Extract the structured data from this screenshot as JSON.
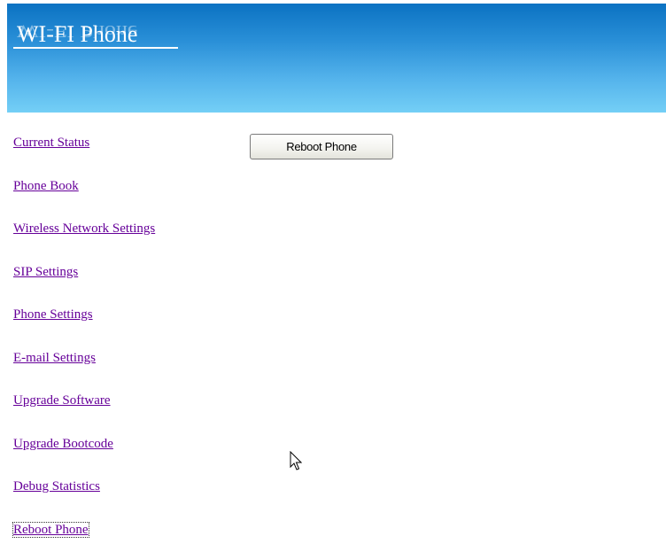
{
  "header": {
    "logo_text": "WI-FI Phone",
    "gradient_top": "#0b72c2",
    "gradient_bottom": "#74cff6"
  },
  "nav": {
    "link_color": "#660099",
    "items": [
      {
        "label": "Current Status"
      },
      {
        "label": "Phone Book"
      },
      {
        "label": "Wireless Network Settings"
      },
      {
        "label": "SIP Settings"
      },
      {
        "label": "Phone Settings"
      },
      {
        "label": "E-mail Settings"
      },
      {
        "label": "Upgrade Software"
      },
      {
        "label": "Upgrade Bootcode"
      },
      {
        "label": "Debug Statistics"
      },
      {
        "label": "Reboot Phone",
        "focused": true
      }
    ]
  },
  "main": {
    "reboot_button_label": "Reboot Phone"
  },
  "cursor": {
    "icon": "arrow-pointer-icon"
  }
}
